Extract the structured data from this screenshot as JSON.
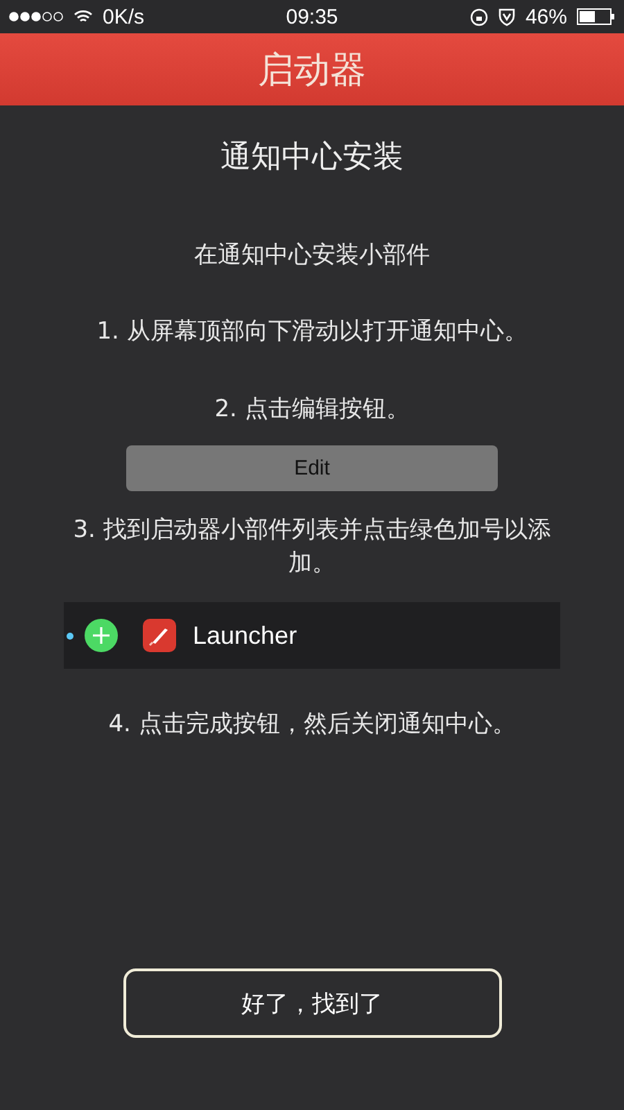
{
  "status_bar": {
    "speed": "0K/s",
    "time": "09:35",
    "battery": "46%"
  },
  "header": {
    "title": "启动器"
  },
  "title": "通知中心安装",
  "subtitle": "在通知中心安装小部件",
  "items": [
    {
      "kind": "step",
      "text": "1. 从屏幕顶部向下滑动以打开通知中心。"
    },
    {
      "kind": "step",
      "text": "2. 点击编辑按钮。"
    },
    {
      "kind": "button",
      "text": "Edit"
    },
    {
      "kind": "step",
      "text": "3. 找到启动器小部件列表并点击绿色加号以添加。"
    },
    {
      "kind": "widget",
      "text": "Launcher"
    },
    {
      "kind": "step",
      "text": "4. 点击完成按钮，然后关闭通知中心。"
    }
  ],
  "ok_button": "好了，找到了"
}
